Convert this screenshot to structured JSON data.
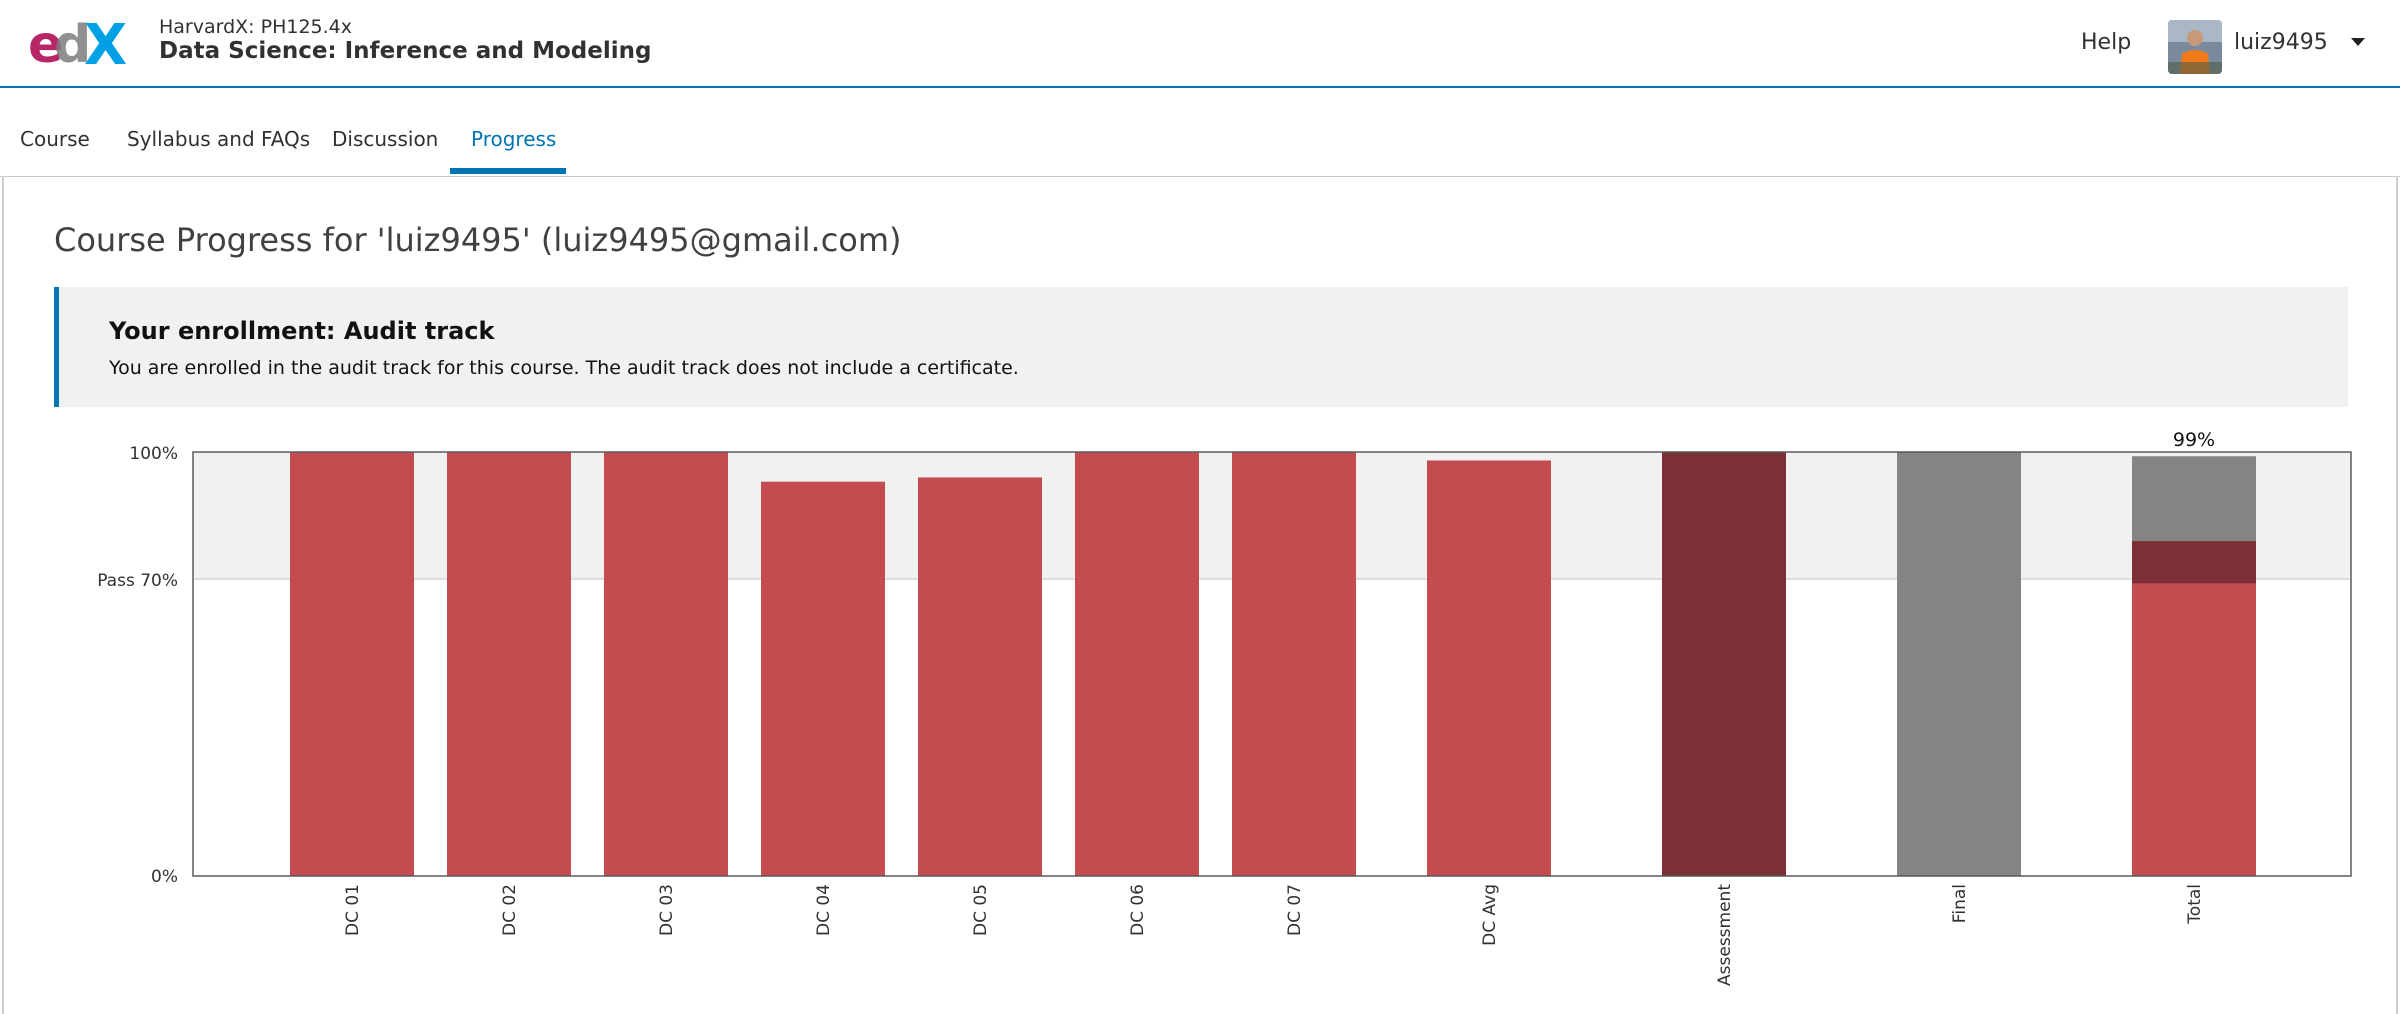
{
  "header": {
    "logo_text": "edX",
    "course_org": "HarvardX: PH125.4x",
    "course_name": "Data Science: Inference and Modeling",
    "help_label": "Help",
    "username": "luiz9495"
  },
  "tabs": [
    {
      "label": "Course",
      "active": false
    },
    {
      "label": "Syllabus and FAQs",
      "active": false
    },
    {
      "label": "Discussion",
      "active": false
    },
    {
      "label": "Progress",
      "active": true
    }
  ],
  "page_title": "Course Progress for 'luiz9495' (luiz9495@gmail.com)",
  "enrollment": {
    "title": "Your enrollment: Audit track",
    "body": "You are enrolled in the audit track for this course. The audit track does not include a certificate."
  },
  "colors": {
    "brand_blue": "#0075b4",
    "bar_red": "#c44c50",
    "assessment_dark": "#7c2f35",
    "gray": "#848484",
    "pass_band": "#f1f1f1"
  },
  "chart_data": {
    "type": "bar",
    "ylim": [
      0,
      100
    ],
    "y_ticks": [
      "100%",
      "Pass 70%",
      "0%"
    ],
    "pass_threshold": 70,
    "categories": [
      "DC 01",
      "DC 02",
      "DC 03",
      "DC 04",
      "DC 05",
      "DC 06",
      "DC 07",
      "DC Avg",
      "Assessment",
      "Final",
      "Total"
    ],
    "values": [
      100,
      100,
      100,
      93,
      94,
      100,
      100,
      98,
      100,
      100,
      99
    ],
    "total_label": "99%",
    "total_breakdown": {
      "dc_portion": 69,
      "assessment_portion": 10,
      "final_portion": 20
    }
  }
}
